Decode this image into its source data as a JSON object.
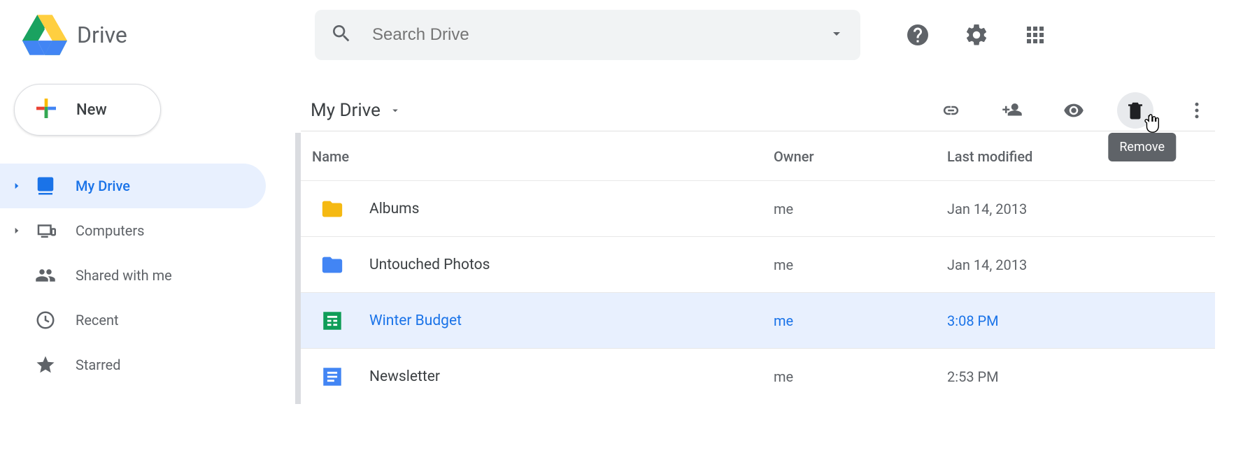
{
  "app": {
    "name": "Drive"
  },
  "search": {
    "placeholder": "Search Drive"
  },
  "sidebar": {
    "new_label": "New",
    "items": [
      {
        "label": "My Drive"
      },
      {
        "label": "Computers"
      },
      {
        "label": "Shared with me"
      },
      {
        "label": "Recent"
      },
      {
        "label": "Starred"
      }
    ]
  },
  "breadcrumb": {
    "label": "My Drive"
  },
  "toolbar": {
    "remove_tooltip": "Remove"
  },
  "columns": {
    "name": "Name",
    "owner": "Owner",
    "modified": "Last modified"
  },
  "files": [
    {
      "name": "Albums",
      "owner": "me",
      "modified": "Jan 14, 2013"
    },
    {
      "name": "Untouched Photos",
      "owner": "me",
      "modified": "Jan 14, 2013"
    },
    {
      "name": "Winter Budget",
      "owner": "me",
      "modified": "3:08 PM"
    },
    {
      "name": "Newsletter",
      "owner": "me",
      "modified": "2:53 PM"
    }
  ]
}
